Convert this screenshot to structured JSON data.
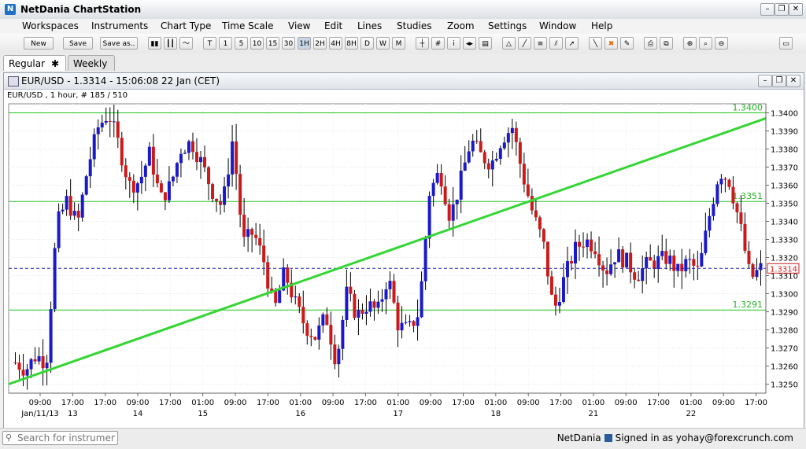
{
  "window": {
    "title": "NetDania ChartStation"
  },
  "menu": [
    "Workspaces",
    "Instruments",
    "Chart Type",
    "Time Scale",
    "View",
    "Edit",
    "Lines",
    "Studies",
    "Zoom",
    "Settings",
    "Window",
    "Help"
  ],
  "toolbar": {
    "new_label": "New",
    "save_label": "Save",
    "save_as_label": "Save as..",
    "timeframes": [
      "T",
      "1",
      "5",
      "10",
      "15",
      "30",
      "1H",
      "2H",
      "4H",
      "8H",
      "D",
      "W",
      "M"
    ],
    "active_timeframe": "1H"
  },
  "tabs": [
    {
      "label": "Regular",
      "close": "✱",
      "active": true
    },
    {
      "label": "Weekly",
      "active": false
    }
  ],
  "chart_window": {
    "title": "EUR/USD - 1.3314 - 15:06:08  22 Jan (CET)",
    "info": "EUR/USD , 1 hour, # 185 / 510"
  },
  "chart_data": {
    "type": "candlestick",
    "instrument": "EUR/USD",
    "interval": "1 hour",
    "last_price": 1.3314,
    "y_range": [
      1.3245,
      1.3405
    ],
    "y_ticks": [
      "1.3400",
      "1.3390",
      "1.3380",
      "1.3370",
      "1.3360",
      "1.3350",
      "1.3340",
      "1.3330",
      "1.3320",
      "1.3310",
      "1.3300",
      "1.3290",
      "1.3280",
      "1.3270",
      "1.3260",
      "1.3250"
    ],
    "price_label": "1.3314",
    "horizontal_levels": [
      {
        "value": 1.34,
        "label": "1.3400"
      },
      {
        "value": 1.3351,
        "label": "1.3351"
      },
      {
        "value": 1.3291,
        "label": "1.3291"
      }
    ],
    "trendline": {
      "from": 1.325,
      "to": 1.3397
    },
    "x_time_labels": [
      "09:00",
      "17:00",
      "17:00",
      "09:00",
      "17:00",
      "01:00",
      "09:00",
      "17:00",
      "01:00",
      "09:00",
      "17:00",
      "01:00",
      "09:00",
      "17:00",
      "01:00",
      "09:00",
      "17:00",
      "01:00",
      "09:00",
      "17:00",
      "01:00",
      "09:00",
      "17:00"
    ],
    "x_date_labels": [
      "Jan/11/13",
      "13",
      "14",
      "15",
      "16",
      "17",
      "18",
      "21",
      "22"
    ],
    "up_color": "#1a1acd",
    "down_color": "#cc1a1a",
    "grid": true,
    "ohlc_close_path": [
      1.3262,
      1.3258,
      1.3266,
      1.3262,
      1.3338,
      1.3352,
      1.3338,
      1.337,
      1.3392,
      1.34,
      1.3382,
      1.336,
      1.3362,
      1.3378,
      1.3352,
      1.336,
      1.338,
      1.3384,
      1.3372,
      1.3357,
      1.3348,
      1.3386,
      1.3328,
      1.3334,
      1.3318,
      1.329,
      1.3312,
      1.3295,
      1.3282,
      1.3276,
      1.3288,
      1.3262,
      1.33,
      1.3288,
      1.3294,
      1.329,
      1.331,
      1.3282,
      1.328,
      1.329,
      1.3356,
      1.3368,
      1.3342,
      1.3362,
      1.3385,
      1.3376,
      1.3372,
      1.3386,
      1.3392,
      1.3366,
      1.3344,
      1.3328,
      1.329,
      1.3308,
      1.3324,
      1.333,
      1.3326,
      1.3312,
      1.3322,
      1.3318,
      1.331,
      1.3316,
      1.3318,
      1.332,
      1.3312,
      1.3318,
      1.3312,
      1.3342,
      1.3368,
      1.3362,
      1.3338,
      1.3308,
      1.3314
    ]
  },
  "status": {
    "search_placeholder": "Search for instrument",
    "brand": "NetDania",
    "signed_in": "Signed in as yohay@forexcrunch.com"
  }
}
